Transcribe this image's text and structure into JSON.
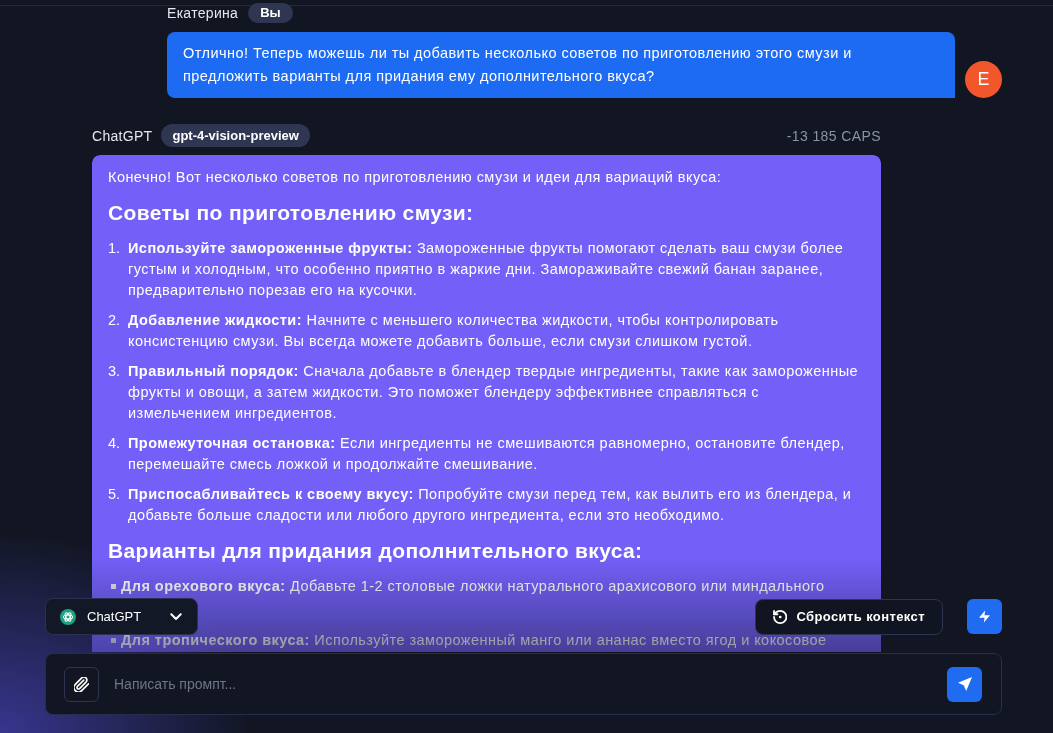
{
  "messages": [
    {
      "kind": "user",
      "author": "Екатерина",
      "badge": "Вы",
      "text": "Отлично! Теперь можешь ли ты добавить несколько советов по приготовлению этого смузи и предложить варианты для придания ему дополнительного вкуса?",
      "avatar": "Е"
    },
    {
      "kind": "assistant",
      "author": "ChatGPT",
      "badge": "gpt-4-vision-preview",
      "cost": "-13 185 CAPS",
      "blocks": [
        {
          "kind": "paragraph",
          "text": "Конечно! Вот несколько советов по приготовлению смузи и идеи для вариаций вкуса:"
        },
        {
          "kind": "heading",
          "text": "Советы по приготовлению смузи:"
        },
        {
          "kind": "ordered_list",
          "items": [
            {
              "number": "1.",
              "text": "**Используйте замороженные фрукты:** Замороженные фрукты помогают сделать ваш смузи более густым и холодным, что особенно приятно в жаркие дни. Замораживайте свежий банан заранее, предварительно порезав его на кусочки."
            },
            {
              "number": "2.",
              "text": "**Добавление жидкости:** Начните с меньшего количества жидкости, чтобы контролировать консистенцию смузи. Вы всегда можете добавить больше, если смузи слишком густой."
            },
            {
              "number": "3.",
              "text": "**Правильный порядок:** Сначала добавьте в блендер твердые ингредиенты, такие как замороженные фрукты и овощи, а затем жидкости. Это поможет блендеру эффективнее справляться с измельчением ингредиентов."
            },
            {
              "number": "4.",
              "text": "**Промежуточная остановка:** Если ингредиенты не смешиваются равномерно, остановите блендер, перемешайте смесь ложкой и продолжайте смешивание."
            },
            {
              "number": "5.",
              "text": "**Приспосабливайтесь к своему вкусу:** Попробуйте смузи перед тем, как вылить его из блендера, и добавьте больше сладости или любого другого ингредиента, если это необходимо."
            }
          ]
        },
        {
          "kind": "heading",
          "text": "Варианты для придания дополнительного вкуса:"
        },
        {
          "kind": "bullet_list",
          "items": [
            {
              "text": "**Для орехового вкуса:** Добавьте 1-2 столовые ложки натурального арахисового или миндального"
            },
            {
              "text": "**Для тропического вкуса:** Используйте замороженный манго или ананас вместо ягод и кокосовое"
            }
          ]
        }
      ]
    }
  ],
  "model_selector": {
    "label": "ChatGPT"
  },
  "reset_button": {
    "label": "Сбросить контекст"
  },
  "composer": {
    "placeholder": "Написать промпт..."
  }
}
